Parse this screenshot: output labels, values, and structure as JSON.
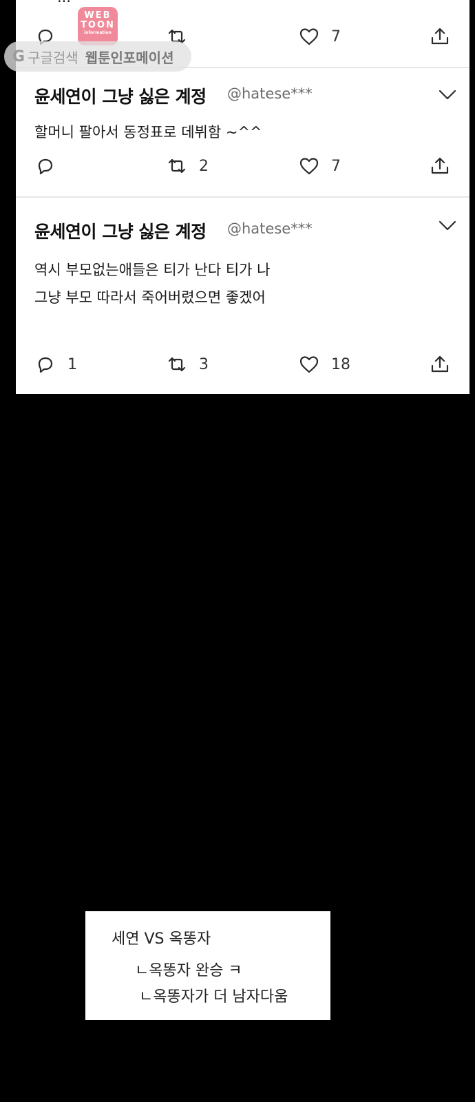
{
  "watermark": {
    "logo_line1": "WEB",
    "logo_line2": "TOON",
    "logo_line3": "information",
    "search_label": "구글검색",
    "site_label": "웹툰인포메이션",
    "google_glyph": "G"
  },
  "tweets": [
    {
      "cut_text": "...",
      "reply_count": "",
      "retweet_count": "",
      "like_count": "7"
    },
    {
      "name": "윤세연이 그냥 싫은 계정",
      "handle": "@hatese***",
      "lines": [
        "할머니 팔아서 동정표로 데뷔함 ~^^"
      ],
      "reply_count": "",
      "retweet_count": "2",
      "like_count": "7"
    },
    {
      "name": "윤세연이 그냥 싫은 계정",
      "handle": "@hatese***",
      "lines": [
        "역시 부모없는애들은 티가 난다 티가 나",
        "그냥 부모 따라서 죽어버렸으면 좋겠어"
      ],
      "reply_count": "1",
      "retweet_count": "3",
      "like_count": "18"
    }
  ],
  "caption": {
    "line1": "세연 VS 옥똥자",
    "line2": "ㄴ옥똥자 완승 ㅋ",
    "line3": "ㄴ옥똥자가 더 남자다움"
  },
  "icons": {
    "reply": "reply-icon",
    "retweet": "retweet-icon",
    "like": "heart-icon",
    "share": "share-icon",
    "more": "chevron-down-icon"
  },
  "colors": {
    "background": "#000000",
    "card": "#ffffff",
    "text": "#111111",
    "handle": "#6b6b6b",
    "watermark_pink": "#f08a9a"
  }
}
